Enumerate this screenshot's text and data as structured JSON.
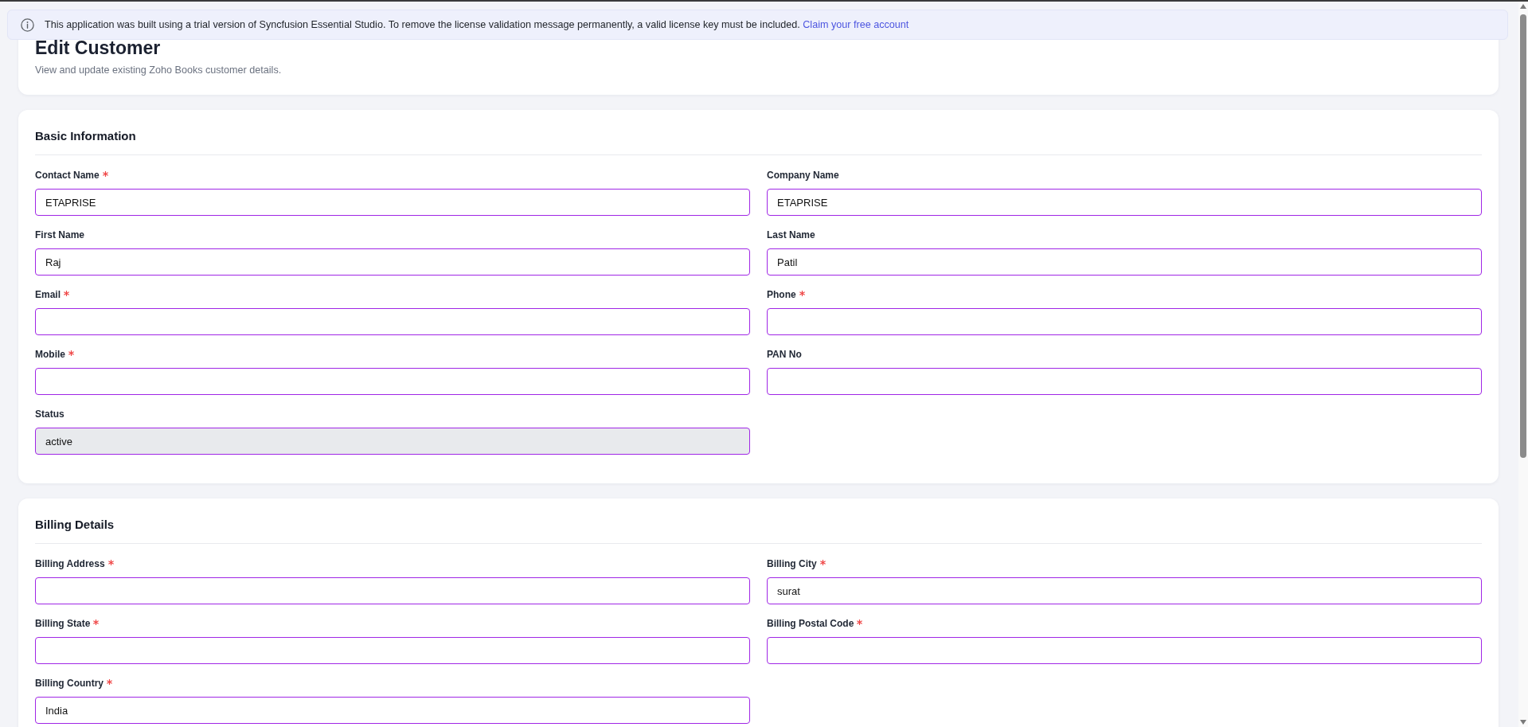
{
  "banner": {
    "message": "This application was built using a trial version of Syncfusion Essential Studio. To remove the license validation message permanently, a valid license key must be included.",
    "link": "Claim your free account"
  },
  "header": {
    "title": "Edit Customer",
    "subtitle": "View and update existing Zoho Books customer details."
  },
  "sections": [
    {
      "title": "Basic Information",
      "fields": [
        {
          "label": "Contact Name",
          "required": true,
          "disabled": false,
          "value": "ETAPRISE"
        },
        {
          "label": "Company Name",
          "required": false,
          "disabled": false,
          "value": "ETAPRISE"
        },
        {
          "label": "First Name",
          "required": false,
          "disabled": false,
          "value": "Raj"
        },
        {
          "label": "Last Name",
          "required": false,
          "disabled": false,
          "value": "Patil"
        },
        {
          "label": "Email",
          "required": true,
          "disabled": false
        },
        {
          "label": "Phone",
          "required": true,
          "disabled": false
        },
        {
          "label": "Mobile",
          "required": true,
          "disabled": false
        },
        {
          "label": "PAN No",
          "required": false,
          "disabled": false
        },
        {
          "label": "Status",
          "required": false,
          "disabled": true,
          "value": "active"
        }
      ]
    },
    {
      "title": "Billing Details",
      "fields": [
        {
          "label": "Billing Address",
          "required": true,
          "disabled": false
        },
        {
          "label": "Billing City",
          "required": true,
          "disabled": false,
          "value": "surat"
        },
        {
          "label": "Billing State",
          "required": true,
          "disabled": false
        },
        {
          "label": "Billing Postal Code",
          "required": true,
          "disabled": false
        },
        {
          "label": "Billing Country",
          "required": true,
          "disabled": false,
          "value": "India"
        }
      ]
    }
  ]
}
